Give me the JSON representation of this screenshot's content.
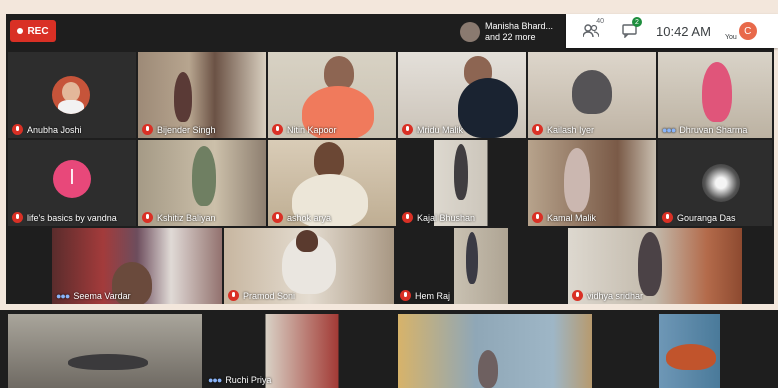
{
  "recording": {
    "label": "REC"
  },
  "presenter": {
    "name": "Manisha Bhard...",
    "more": "and 22 more"
  },
  "topbar": {
    "participants_count": "40",
    "chat_count": "2",
    "time": "10:42 AM",
    "you_label": "You",
    "you_initial": "C"
  },
  "row1": [
    {
      "name": "Anubha Joshi",
      "muted": true
    },
    {
      "name": "Bijender Singh",
      "muted": true
    },
    {
      "name": "Nitin Kapoor",
      "muted": true
    },
    {
      "name": "Mridu Malik",
      "muted": true
    },
    {
      "name": "Kailash Iyer",
      "muted": true
    },
    {
      "name": "Dhruvan Sharma",
      "muted": false
    }
  ],
  "row2": [
    {
      "name": "life's basics by vandna",
      "muted": true,
      "initial": "l"
    },
    {
      "name": "Kshitiz Baliyan",
      "muted": true
    },
    {
      "name": "ashok arya",
      "muted": true
    },
    {
      "name": "Kajal Bhushan",
      "muted": true
    },
    {
      "name": "Kamal Malik",
      "muted": true
    },
    {
      "name": "Gouranga Das",
      "muted": true
    }
  ],
  "row3": [
    {
      "name": "Seema Vardar",
      "muted": false
    },
    {
      "name": "Pramod Soni",
      "muted": true
    },
    {
      "name": "Hem Raj",
      "muted": true
    },
    {
      "name": "vidhya sridhar",
      "muted": true
    }
  ],
  "row4": [
    {
      "name": "Ruchi Priya",
      "muted": false
    }
  ]
}
